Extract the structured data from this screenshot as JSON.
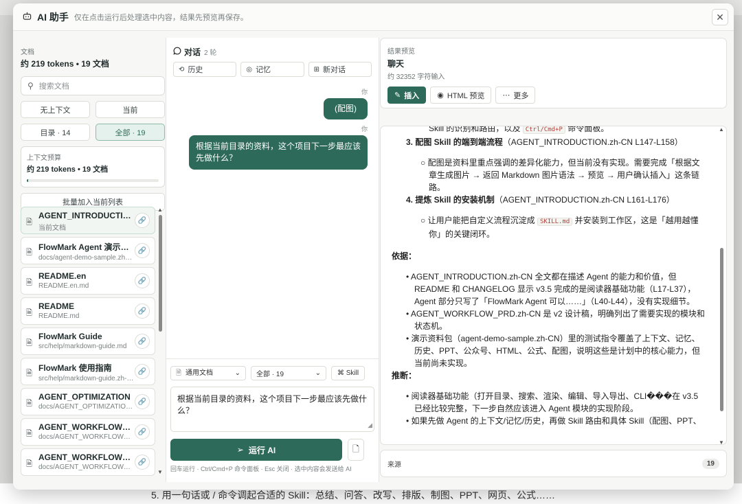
{
  "background": {
    "footer_text": "5. 用一句话或 / 命令调起合适的 Skill：总结、问答、改写、排版、制图、PPT、网页、公式……"
  },
  "header": {
    "title": "AI 助手",
    "subtitle": "仅在点击运行后处理选中内容，结果先预览再保存。",
    "close_label": "✕"
  },
  "left": {
    "docs_label": "文档",
    "docs_summary": "约 219 tokens • 19 文档",
    "search_placeholder": "搜索文档",
    "scope_buttons": [
      "无上下文",
      "当前",
      "目录 · 14",
      "全部 · 19"
    ],
    "budget_label": "上下文预算",
    "budget_value": "约 219 tokens • 19 文档",
    "budget_fraction": 0.01,
    "batch_label": "批量加入当前列表",
    "docs": [
      {
        "name": "AGENT_INTRODUCTION.zh-CN.md",
        "path": "当前文档"
      },
      {
        "name": "FlowMark Agent 演示资料包",
        "path": "docs/agent-demo-sample.zh-CN.md"
      },
      {
        "name": "README.en",
        "path": "README.en.md"
      },
      {
        "name": "README",
        "path": "README.md"
      },
      {
        "name": "FlowMark Guide",
        "path": "src/help/markdown-guide.md"
      },
      {
        "name": "FlowMark 使用指南",
        "path": "src/help/markdown-guide.zh-CN.md"
      },
      {
        "name": "AGENT_OPTIMIZATION",
        "path": "docs/AGENT_OPTIMIZATION.md"
      },
      {
        "name": "AGENT_WORKFLOW_PRD",
        "path": "docs/AGENT_WORKFLOW_PRD.md"
      },
      {
        "name": "AGENT_WORKFLOW_PRD.zh-CN",
        "path": "docs/AGENT_WORKFLOW_PRD.zh-CN.md"
      }
    ]
  },
  "mid": {
    "title": "对话",
    "count": "2 轮",
    "tabs": [
      "历史",
      "记忆",
      "新对话"
    ],
    "messages": [
      {
        "who": "你",
        "text": "(配图)"
      },
      {
        "who": "你",
        "text": "根据当前目录的资料，这个项目下一步最应该先做什么？"
      }
    ],
    "doc_type": "通用文档",
    "scope": "全部 · 19",
    "skill_label": "⌘ Skill",
    "input_text": "根据当前目录的资料，这个项目下一步最应该先做什么？",
    "run_label": "运行 AI",
    "hint": "回车运行 · Ctrl/Cmd+P 命令面板 · Esc 关闭 · 选中内容会发送给 AI"
  },
  "right": {
    "preview_label": "结果预览",
    "preview_name": "聊天",
    "preview_sub": "约 32352 字符输入",
    "actions": [
      "插入",
      "HTML 预览",
      "更多"
    ],
    "source_label": "来源",
    "source_count": "19",
    "content": {
      "l0a": "Skill 的识别和路由，以及",
      "l0code": "Ctrl/Cmd+P",
      "l0b": "命令面板。",
      "i3_head": "3. 配图 Skill 的端到端流程",
      "i3_ref": "（AGENT_INTRODUCTION.zh-CN L147-L158）",
      "i3_sub": "○ 配图是资料里重点强调的差异化能力，但当前没有实现。需要完成「根据文章生成图片 → 返回 Markdown 图片语法 → 预览 → 用户确认插入」这条链路。",
      "i4_head": "4. 提炼 Skill 的安装机制",
      "i4_ref": "（AGENT_INTRODUCTION.zh-CN L161-L176）",
      "i4_sub_a": "○ 让用户能把自定义流程沉淀成",
      "i4_code": "SKILL.md",
      "i4_sub_b": "并安装到工作区，这是「越用越懂你」的关键闭环。",
      "basis_h": "依据：",
      "basis": [
        "• AGENT_INTRODUCTION.zh-CN 全文都在描述 Agent 的能力和价值，但 README 和 CHANGELOG 显示 v3.5 完成的是阅读器基础功能（L17-L37），Agent 部分只写了「FlowMark Agent 可以……」（L40-L44），没有实现细节。",
        "• AGENT_WORKFLOW_PRD.zh-CN 是 v2 设计稿，明确列出了需要实现的模块和状态机。",
        "• 演示资料包（agent-demo-sample.zh-CN）里的测试指令覆盖了上下文、记忆、历史、PPT、公众号、HTML、公式、配图，说明这些是计划中的核心能力，但当前尚未实现。"
      ],
      "infer_h": "推断：",
      "infer": [
        "• 阅读器基础功能（打开目录、搜索、渲染、编辑、导入导出、CLI���在 v3.5 已经比较完整，下一步自然应该进入 Agent 模块的实现阶段。",
        "• 如果先做 Agent 的上下文/记忆/历史，再做 Skill 路由和具体 Skill（配图、PPT、"
      ]
    }
  }
}
